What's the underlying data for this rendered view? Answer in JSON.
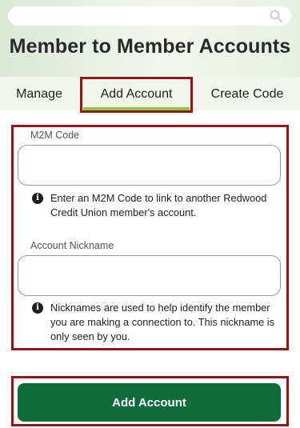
{
  "search": {
    "placeholder": ""
  },
  "page": {
    "title": "Member to Member Accounts"
  },
  "tabs": [
    {
      "label": "Manage"
    },
    {
      "label": "Add Account"
    },
    {
      "label": "Create Code"
    }
  ],
  "form": {
    "m2m_code": {
      "label": "M2M Code",
      "value": "",
      "help": "Enter an M2M Code to link to another Redwood Credit Union member's account."
    },
    "nickname": {
      "label": "Account Nickname",
      "value": "",
      "help": "Nicknames are used to help identify the member you are making a connection to. This nickname is only seen by you."
    },
    "submit_label": "Add Account"
  },
  "colors": {
    "primary_button": "#0f6b3a",
    "active_tab_underline": "#8dc63f",
    "highlight_border": "#8b1a1a"
  },
  "icons": {
    "search": "search-icon",
    "info": "info-icon"
  }
}
